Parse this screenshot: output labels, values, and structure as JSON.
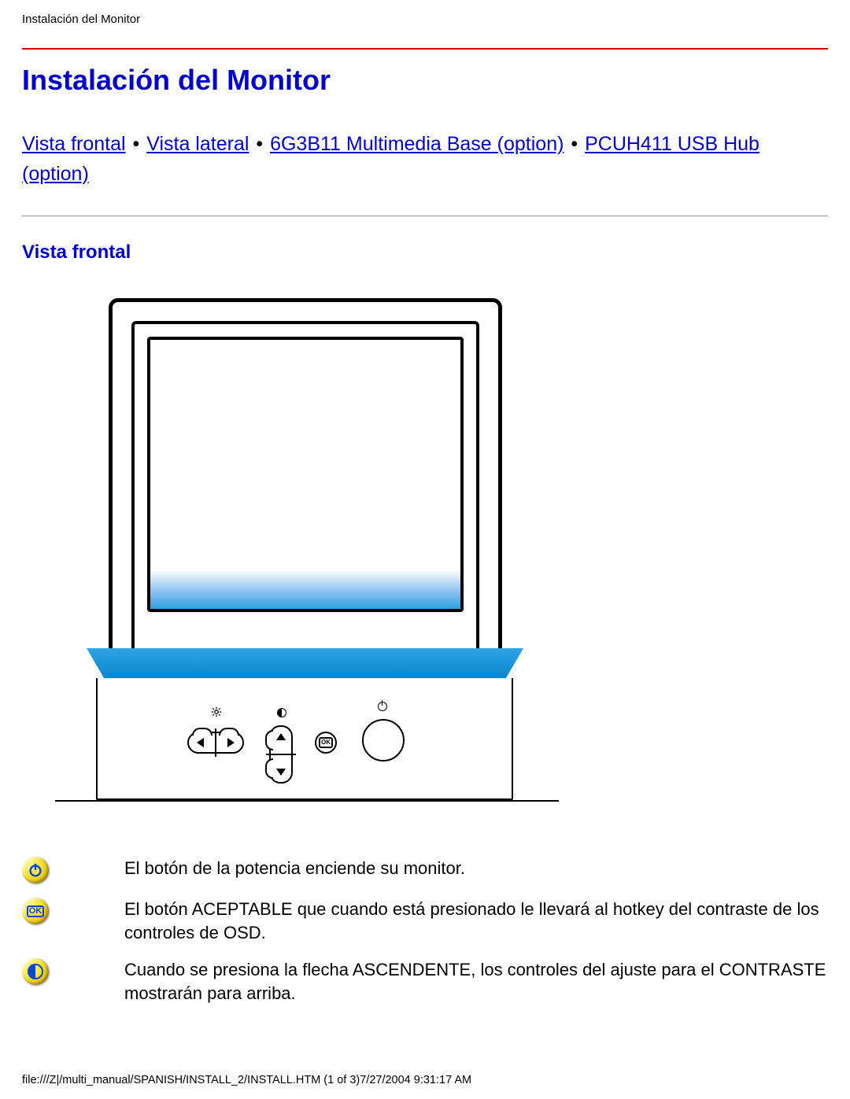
{
  "header": "Instalación del Monitor",
  "title": "Instalación del Monitor",
  "nav": {
    "links": [
      "Vista frontal",
      "Vista lateral",
      "6G3B11 Multimedia Base (option)",
      "PCUH411 USB Hub (option)"
    ],
    "sep": "•"
  },
  "section_heading": "Vista frontal",
  "diagram": {
    "controls": {
      "brightness_label": "brightness",
      "contrast_label": "contrast",
      "power_label": "power",
      "ok_label": "OK"
    }
  },
  "legend": [
    {
      "icon": "power",
      "text": "El botón de la potencia enciende su monitor."
    },
    {
      "icon": "ok",
      "text": "El botón ACEPTABLE que cuando está presionado le llevará al hotkey del contraste de los controles de OSD."
    },
    {
      "icon": "contrast",
      "text": "Cuando se presiona la flecha ASCENDENTE, los controles del ajuste para el CONTRASTE mostrarán para arriba."
    }
  ],
  "footer": "file:///Z|/multi_manual/SPANISH/INSTALL_2/INSTALL.HTM (1 of 3)7/27/2004 9:31:17 AM"
}
